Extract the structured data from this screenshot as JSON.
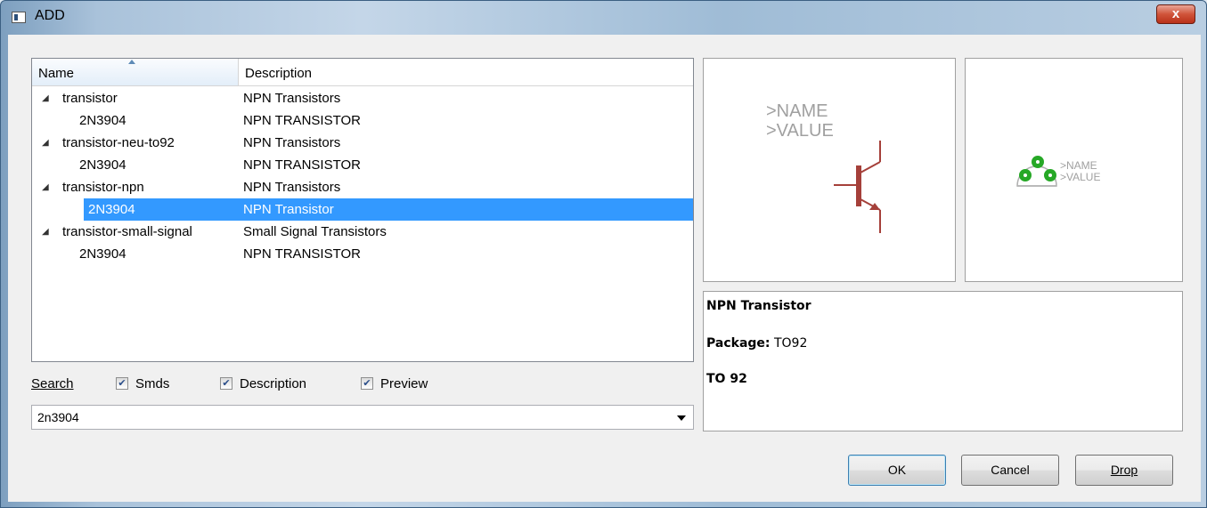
{
  "window": {
    "title": "ADD",
    "close_label": "x"
  },
  "tree": {
    "columns": {
      "name": "Name",
      "description": "Description"
    },
    "rows": [
      {
        "name": "transistor",
        "description": "NPN Transistors",
        "level": 0,
        "expanded": true
      },
      {
        "name": "2N3904",
        "description": "NPN TRANSISTOR",
        "level": 1
      },
      {
        "name": "transistor-neu-to92",
        "description": "NPN Transistors",
        "level": 0,
        "expanded": true
      },
      {
        "name": "2N3904",
        "description": "NPN TRANSISTOR",
        "level": 1
      },
      {
        "name": "transistor-npn",
        "description": "NPN Transistors",
        "level": 0,
        "expanded": true
      },
      {
        "name": "2N3904",
        "description": "NPN Transistor",
        "level": 1,
        "selected": true
      },
      {
        "name": "transistor-small-signal",
        "description": "Small Signal Transistors",
        "level": 0,
        "expanded": true
      },
      {
        "name": "2N3904",
        "description": "NPN TRANSISTOR",
        "level": 1
      }
    ],
    "expander_glyph": "◢"
  },
  "search": {
    "label": "Search",
    "smds_label": "Smds",
    "smds_checked": true,
    "description_label": "Description",
    "description_checked": true,
    "preview_label": "Preview",
    "preview_checked": true,
    "query": "2n3904",
    "check_glyph": "✔"
  },
  "symbol_preview": {
    "name_text": ">NAME",
    "value_text": ">VALUE",
    "symbol_color": "#a5403a"
  },
  "package_preview": {
    "name_text": ">NAME",
    "value_text": ">VALUE",
    "pad_color": "#26a826"
  },
  "info": {
    "title": "NPN Transistor",
    "package_label": "Package:",
    "package_value": "TO92",
    "footer": "TO 92"
  },
  "buttons": {
    "ok": "OK",
    "cancel": "Cancel",
    "drop": "Drop"
  },
  "colors": {
    "selection": "#3399ff",
    "default_button_border": "#3c7fb1"
  }
}
